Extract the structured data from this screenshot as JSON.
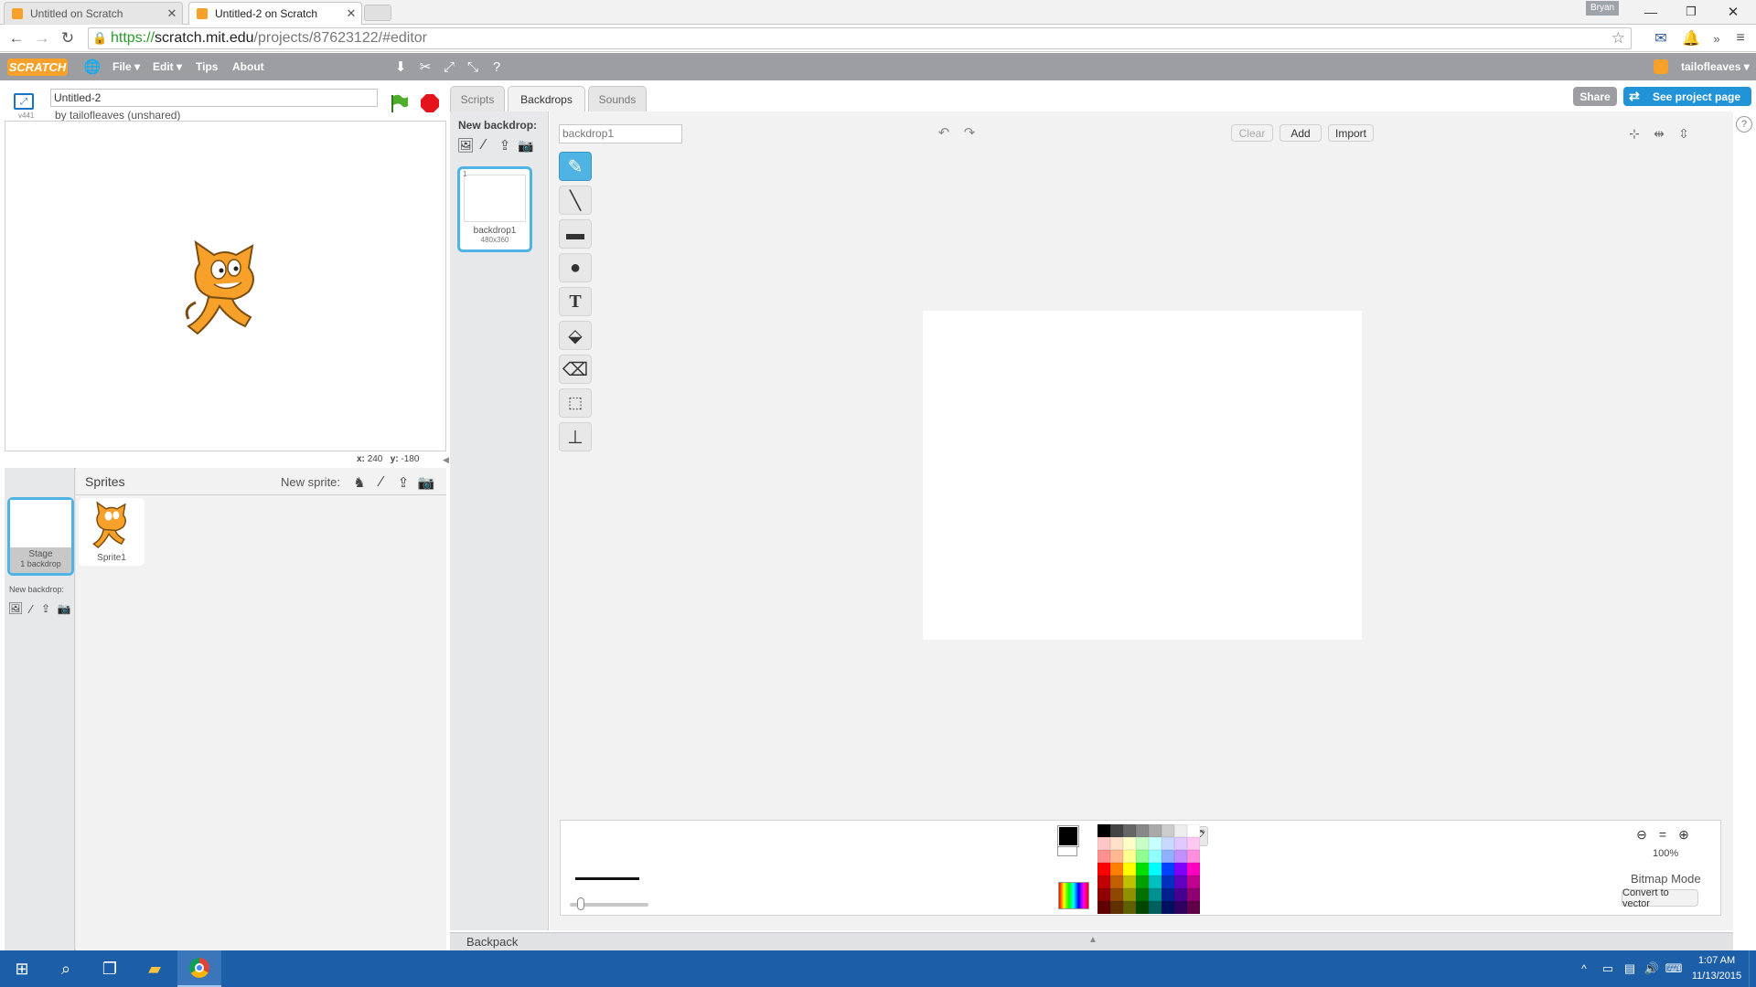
{
  "browser": {
    "tabs": [
      {
        "label": "Untitled on Scratch",
        "active": false
      },
      {
        "label": "Untitled-2 on Scratch",
        "active": true
      }
    ],
    "url_scheme": "https://",
    "url_host": "scratch.mit.edu",
    "url_path": "/projects/87623122/#editor",
    "user_badge": "Bryan"
  },
  "menubar": {
    "logo": "SCRATCH",
    "file": "File ▾",
    "edit": "Edit ▾",
    "tips": "Tips",
    "about": "About",
    "username": "tailofleaves ▾"
  },
  "stage": {
    "version": "v441",
    "project_title": "Untitled-2",
    "byline": "by tailofleaves (unshared)",
    "x_label": "x:",
    "x_value": "240",
    "y_label": "y:",
    "y_value": "-180"
  },
  "sprites": {
    "header": "Sprites",
    "new_sprite_label": "New sprite:",
    "stage_thumb_label": "Stage",
    "stage_thumb_sub": "1 backdrop",
    "new_backdrop_label": "New backdrop:",
    "sprite1_label": "Sprite1"
  },
  "tabs": {
    "scripts": "Scripts",
    "backdrops": "Backdrops",
    "sounds": "Sounds"
  },
  "share": {
    "share": "Share",
    "see_project": "See project page"
  },
  "backdrops": {
    "new_backdrop_label": "New backdrop:",
    "item_index": "1",
    "item_name": "backdrop1",
    "item_size": "480x360"
  },
  "editor": {
    "name_field_value": "backdrop1",
    "clear": "Clear",
    "add": "Add",
    "import": "Import",
    "zoom_level": "100%",
    "mode": "Bitmap Mode",
    "convert": "Convert to vector"
  },
  "backpack": {
    "label": "Backpack"
  },
  "taskbar": {
    "time": "1:07 AM",
    "date": "11/13/2015"
  },
  "colors": {
    "scratch_orange": "#f7a12a",
    "menu_gray": "#9c9ea2",
    "accent_blue": "#4fb3e4",
    "share_orange": "#f9a534",
    "see_project_blue": "#2193d7",
    "taskbar_blue": "#1d5ea8"
  },
  "icons": [
    "globe-icon",
    "green-flag-icon",
    "stop-icon",
    "fullscreen-icon",
    "paint-brush-icon",
    "line-icon",
    "rectangle-icon",
    "ellipse-icon",
    "text-icon",
    "fill-icon",
    "eraser-icon",
    "select-icon",
    "stamp-icon",
    "undo-icon",
    "redo-icon",
    "zoom-out-icon",
    "zoom-reset-icon",
    "zoom-in-icon",
    "eyedropper-icon"
  ]
}
